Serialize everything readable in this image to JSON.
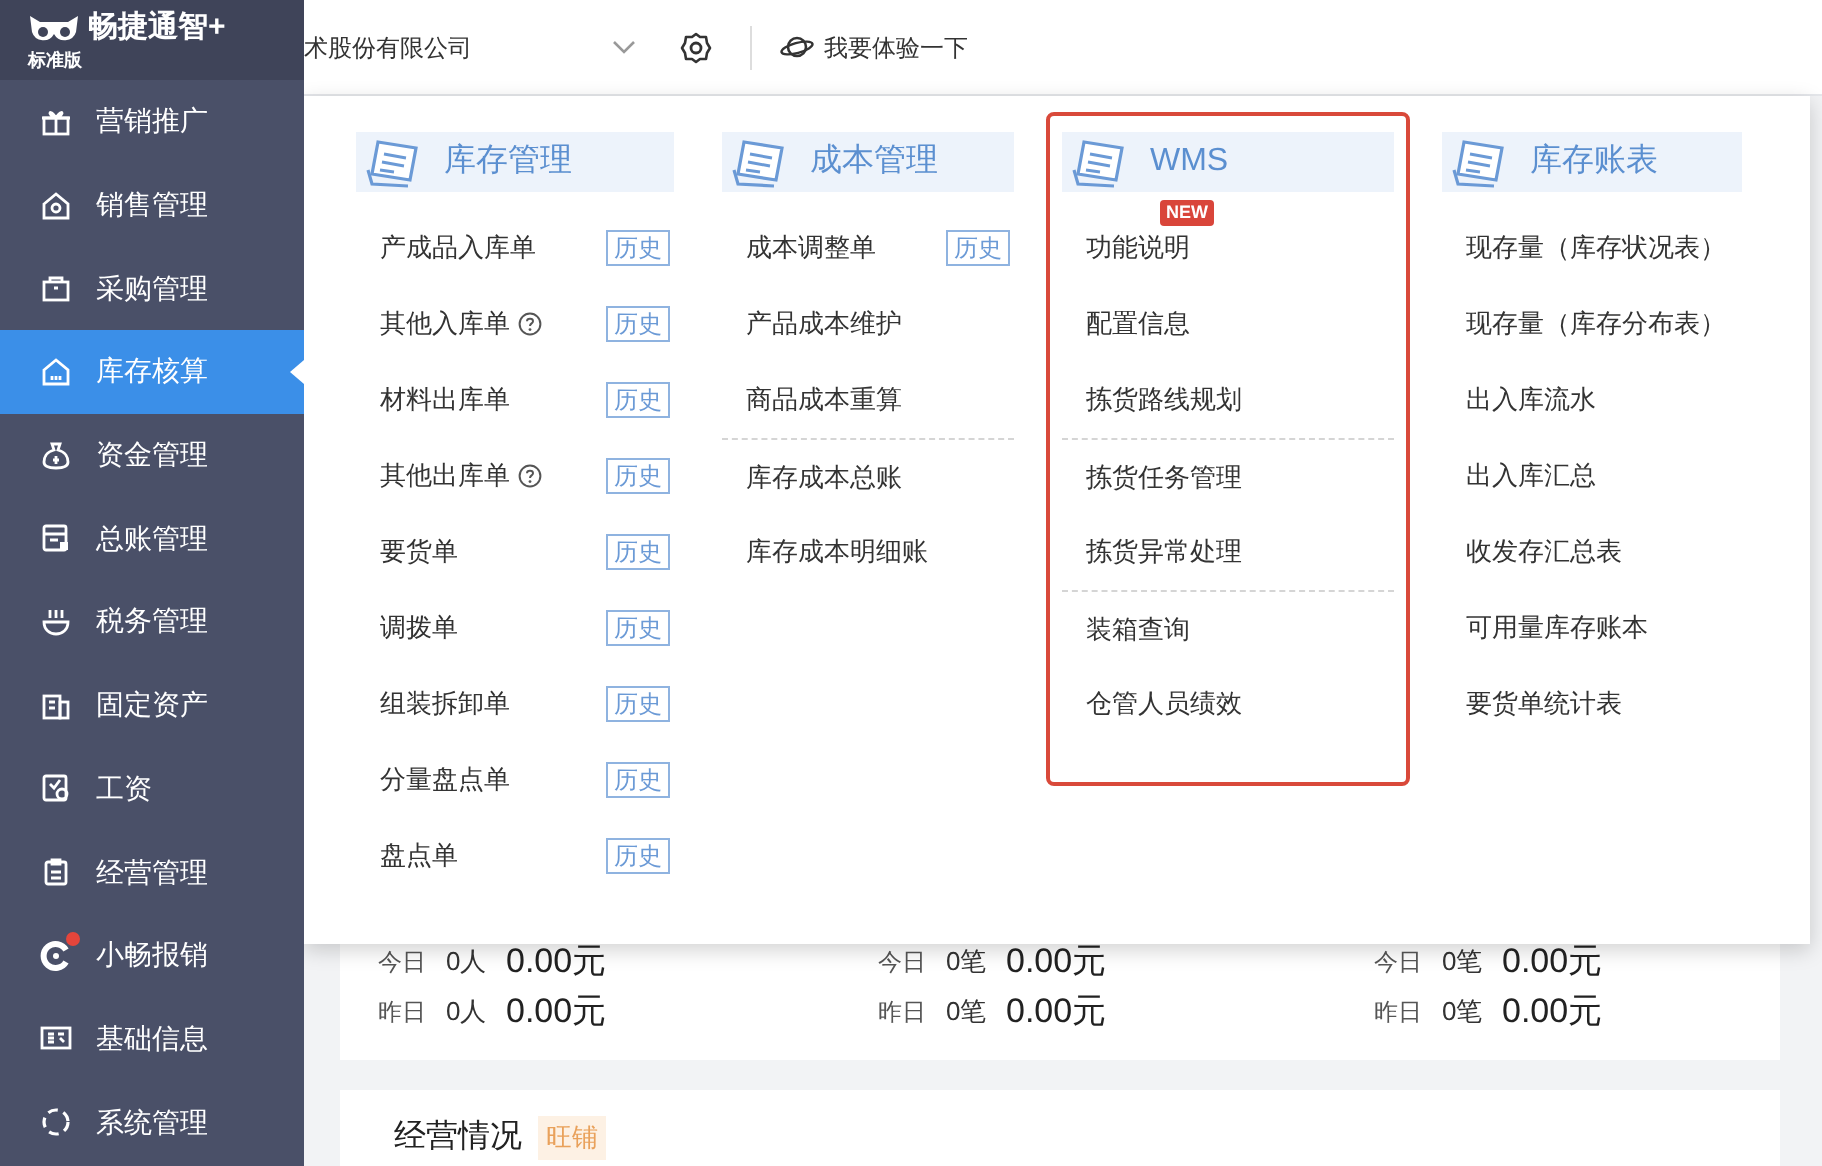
{
  "brand": {
    "name": "畅捷通智+",
    "edition": "标准版"
  },
  "header": {
    "company": "术股份有限公司",
    "trial_link": "我要体验一下"
  },
  "sidebar": {
    "items": [
      {
        "label": "营销推广",
        "selected": false,
        "dot": false
      },
      {
        "label": "销售管理",
        "selected": false,
        "dot": false
      },
      {
        "label": "采购管理",
        "selected": false,
        "dot": false
      },
      {
        "label": "库存核算",
        "selected": true,
        "dot": false
      },
      {
        "label": "资金管理",
        "selected": false,
        "dot": false
      },
      {
        "label": "总账管理",
        "selected": false,
        "dot": false
      },
      {
        "label": "税务管理",
        "selected": false,
        "dot": false
      },
      {
        "label": "固定资产",
        "selected": false,
        "dot": false
      },
      {
        "label": "工资",
        "selected": false,
        "dot": false
      },
      {
        "label": "经营管理",
        "selected": false,
        "dot": false
      },
      {
        "label": "小畅报销",
        "selected": false,
        "dot": true
      },
      {
        "label": "基础信息",
        "selected": false,
        "dot": false
      },
      {
        "label": "系统管理",
        "selected": false,
        "dot": false
      }
    ]
  },
  "menu": {
    "columns": [
      {
        "title": "库存管理",
        "framed": false,
        "groups": [
          [
            {
              "label": "产成品入库单",
              "help": false,
              "history": "历史"
            },
            {
              "label": "其他入库单",
              "help": true,
              "history": "历史"
            },
            {
              "label": "材料出库单",
              "help": false,
              "history": "历史"
            },
            {
              "label": "其他出库单",
              "help": true,
              "history": "历史"
            },
            {
              "label": "要货单",
              "help": false,
              "history": "历史"
            },
            {
              "label": "调拨单",
              "help": false,
              "history": "历史"
            },
            {
              "label": "组装拆卸单",
              "help": false,
              "history": "历史"
            },
            {
              "label": "分量盘点单",
              "help": false,
              "history": "历史"
            },
            {
              "label": "盘点单",
              "help": false,
              "history": "历史"
            }
          ]
        ]
      },
      {
        "title": "成本管理",
        "framed": false,
        "groups": [
          [
            {
              "label": "成本调整单",
              "help": false,
              "history": "历史"
            },
            {
              "label": "产品成本维护",
              "help": false
            },
            {
              "label": "商品成本重算",
              "help": false
            }
          ],
          [
            {
              "label": "库存成本总账",
              "help": false
            },
            {
              "label": "库存成本明细账",
              "help": false
            }
          ]
        ]
      },
      {
        "title": "WMS",
        "framed": true,
        "groups": [
          [
            {
              "label": "功能说明",
              "help": false,
              "badge": "NEW"
            },
            {
              "label": "配置信息",
              "help": false
            },
            {
              "label": "拣货路线规划",
              "help": false
            }
          ],
          [
            {
              "label": "拣货任务管理",
              "help": false
            },
            {
              "label": "拣货异常处理",
              "help": false
            }
          ],
          [
            {
              "label": "装箱查询",
              "help": false
            },
            {
              "label": "仓管人员绩效",
              "help": false
            }
          ]
        ]
      },
      {
        "title": "库存账表",
        "framed": false,
        "groups": [
          [
            {
              "label": "现存量（库存状况表）",
              "help": false
            },
            {
              "label": "现存量（库存分布表）",
              "help": false
            },
            {
              "label": "出入库流水",
              "help": false
            },
            {
              "label": "出入库汇总",
              "help": false
            },
            {
              "label": "收发存汇总表",
              "help": false
            },
            {
              "label": "可用量库存账本",
              "help": false
            },
            {
              "label": "要货单统计表",
              "help": false
            }
          ]
        ]
      }
    ]
  },
  "stats": {
    "columns": [
      {
        "rows": [
          {
            "day": "今日",
            "count": "0人",
            "amount": "0.00元"
          },
          {
            "day": "昨日",
            "count": "0人",
            "amount": "0.00元"
          }
        ]
      },
      {
        "rows": [
          {
            "day": "今日",
            "count": "0笔",
            "amount": "0.00元"
          },
          {
            "day": "昨日",
            "count": "0笔",
            "amount": "0.00元"
          }
        ]
      },
      {
        "rows": [
          {
            "day": "今日",
            "count": "0笔",
            "amount": "0.00元"
          },
          {
            "day": "昨日",
            "count": "0笔",
            "amount": "0.00元"
          }
        ]
      }
    ]
  },
  "business": {
    "title": "经营情况",
    "tag": "旺铺"
  }
}
